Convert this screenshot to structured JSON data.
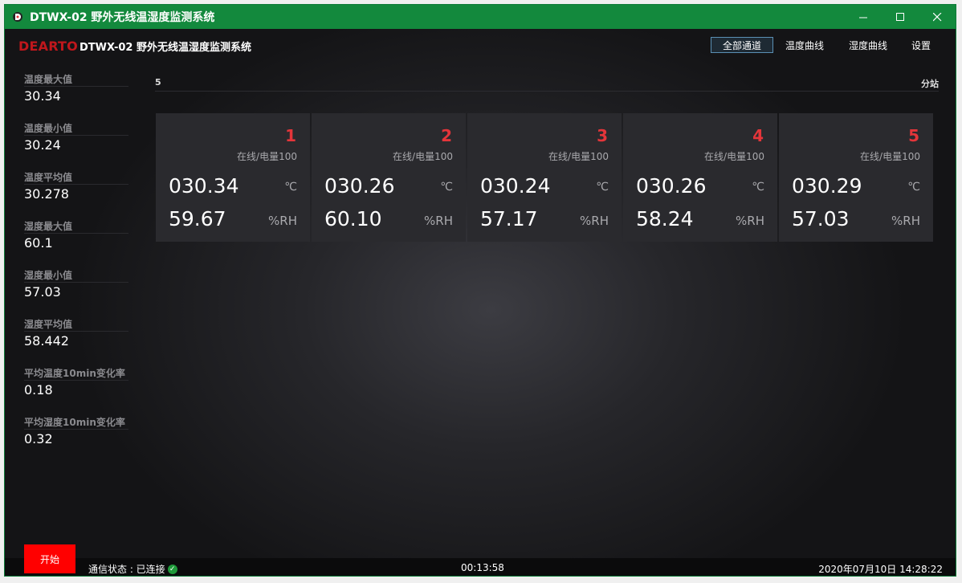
{
  "window": {
    "title": "DTWX-02 野外无线温湿度监测系统",
    "controls": {
      "minimize": "—",
      "maximize": "☐",
      "close": "✕"
    }
  },
  "header": {
    "brand": "DEARTO",
    "app_title": "DTWX-02 野外无线温湿度监测系统",
    "tabs": [
      {
        "label": "全部通道",
        "active": true
      },
      {
        "label": "温度曲线",
        "active": false
      },
      {
        "label": "湿度曲线",
        "active": false
      },
      {
        "label": "设置",
        "active": false
      }
    ]
  },
  "stats": [
    {
      "label": "温度最大值",
      "value": "30.34"
    },
    {
      "label": "温度最小值",
      "value": "30.24"
    },
    {
      "label": "温度平均值",
      "value": "30.278"
    },
    {
      "label": "湿度最大值",
      "value": "60.1"
    },
    {
      "label": "湿度最小值",
      "value": "57.03"
    },
    {
      "label": "湿度平均值",
      "value": "58.442"
    },
    {
      "label": "平均温度10min变化率",
      "value": "0.18"
    },
    {
      "label": "平均湿度10min变化率",
      "value": "0.32"
    }
  ],
  "station_list": {
    "count": "5",
    "label": "分站"
  },
  "stations": [
    {
      "id": "1",
      "status": "在线/电量100",
      "temp": "030.34",
      "temp_unit": "℃",
      "humidity": "59.67",
      "hum_unit": "%RH"
    },
    {
      "id": "2",
      "status": "在线/电量100",
      "temp": "030.26",
      "temp_unit": "℃",
      "humidity": "60.10",
      "hum_unit": "%RH"
    },
    {
      "id": "3",
      "status": "在线/电量100",
      "temp": "030.24",
      "temp_unit": "℃",
      "humidity": "57.17",
      "hum_unit": "%RH"
    },
    {
      "id": "4",
      "status": "在线/电量100",
      "temp": "030.26",
      "temp_unit": "℃",
      "humidity": "58.24",
      "hum_unit": "%RH"
    },
    {
      "id": "5",
      "status": "在线/电量100",
      "temp": "030.29",
      "temp_unit": "℃",
      "humidity": "57.03",
      "hum_unit": "%RH"
    }
  ],
  "footer": {
    "start_label": "开始",
    "comm_status": "通信状态 : 已连接",
    "elapsed": "00:13:58",
    "datetime": "2020年07月10日 14:28:22"
  },
  "colors": {
    "title_bar": "#13893d",
    "brand": "#c0171c",
    "station_id": "#e4353a",
    "start_button": "#ff0000"
  }
}
